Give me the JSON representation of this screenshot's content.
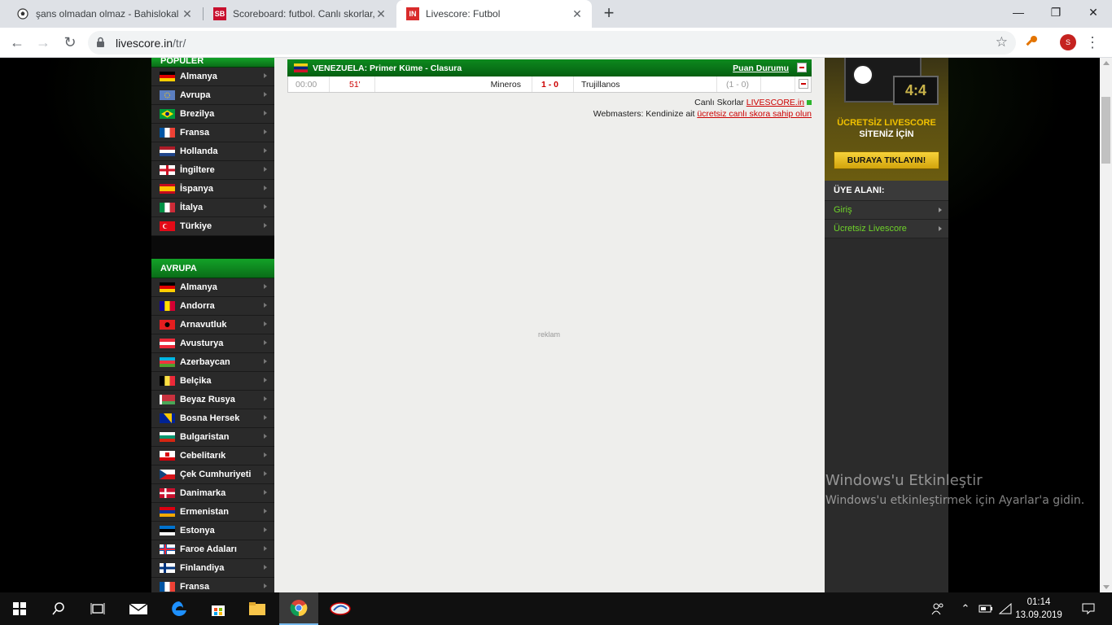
{
  "browser": {
    "tabs": [
      {
        "title": "şans olmadan olmaz - Bahislokal",
        "favicon": "soccer-ball-icon"
      },
      {
        "title": "Scoreboard: futbol. Canlı skorlar,",
        "favicon": "sb-logo-icon",
        "favicon_text": "SB"
      },
      {
        "title": "Livescore: Futbol",
        "favicon": "livescore-logo-icon",
        "favicon_text": "IN",
        "active": true
      }
    ],
    "url_host": "livescore.in",
    "url_path": "/tr/",
    "profile_initial": "S"
  },
  "sidebar": {
    "popular_heading": "POPÜLER",
    "popular": [
      {
        "label": "Almanya",
        "flag": "de"
      },
      {
        "label": "Avrupa",
        "flag": "eu"
      },
      {
        "label": "Brezilya",
        "flag": "br"
      },
      {
        "label": "Fransa",
        "flag": "fr"
      },
      {
        "label": "Hollanda",
        "flag": "nl"
      },
      {
        "label": "İngiltere",
        "flag": "en"
      },
      {
        "label": "İspanya",
        "flag": "es"
      },
      {
        "label": "İtalya",
        "flag": "it"
      },
      {
        "label": "Türkiye",
        "flag": "tr"
      }
    ],
    "europe_heading": "AVRUPA",
    "europe": [
      {
        "label": "Almanya",
        "flag": "de"
      },
      {
        "label": "Andorra",
        "flag": "ad"
      },
      {
        "label": "Arnavutluk",
        "flag": "al"
      },
      {
        "label": "Avusturya",
        "flag": "at"
      },
      {
        "label": "Azerbaycan",
        "flag": "az"
      },
      {
        "label": "Belçika",
        "flag": "be"
      },
      {
        "label": "Beyaz Rusya",
        "flag": "by"
      },
      {
        "label": "Bosna Hersek",
        "flag": "ba"
      },
      {
        "label": "Bulgaristan",
        "flag": "bg"
      },
      {
        "label": "Cebelitarık",
        "flag": "gi"
      },
      {
        "label": "Çek Cumhuriyeti",
        "flag": "cz"
      },
      {
        "label": "Danimarka",
        "flag": "dk"
      },
      {
        "label": "Ermenistan",
        "flag": "am"
      },
      {
        "label": "Estonya",
        "flag": "ee"
      },
      {
        "label": "Faroe Adaları",
        "flag": "fo"
      },
      {
        "label": "Finlandiya",
        "flag": "fi"
      },
      {
        "label": "Fransa",
        "flag": "fr"
      }
    ]
  },
  "league": {
    "name": "VENEZUELA: Primer Küme - Clasura",
    "standings_link": "Puan Durumu",
    "match": {
      "time": "00:00",
      "minute": "51'",
      "home": "Mineros",
      "score": "1 - 0",
      "away": "Trujillanos",
      "half_time": "(1 - 0)"
    }
  },
  "credit": {
    "line1_prefix": "Canlı Skorlar",
    "line1_link": "LIVESCORE.in",
    "line2_prefix": "Webmasters: Kendinize ait",
    "line2_link": "ücretsiz canlı skora sahip olun"
  },
  "ad_label": "reklam",
  "promo": {
    "score_display": "4:4",
    "line1": "ÜCRETSİZ LIVESCORE",
    "line2": "SİTENİZ İÇİN",
    "button": "BURAYA TIKLAYIN!"
  },
  "member": {
    "heading": "ÜYE ALANI:",
    "items": [
      "Giriş",
      "Ücretsiz Livescore"
    ]
  },
  "activation": {
    "title": "Windows'u Etkinleştir",
    "subtitle": "Windows'u etkinleştirmek için Ayarlar'a gidin."
  },
  "taskbar": {
    "time": "01:14",
    "date": "13.09.2019"
  }
}
